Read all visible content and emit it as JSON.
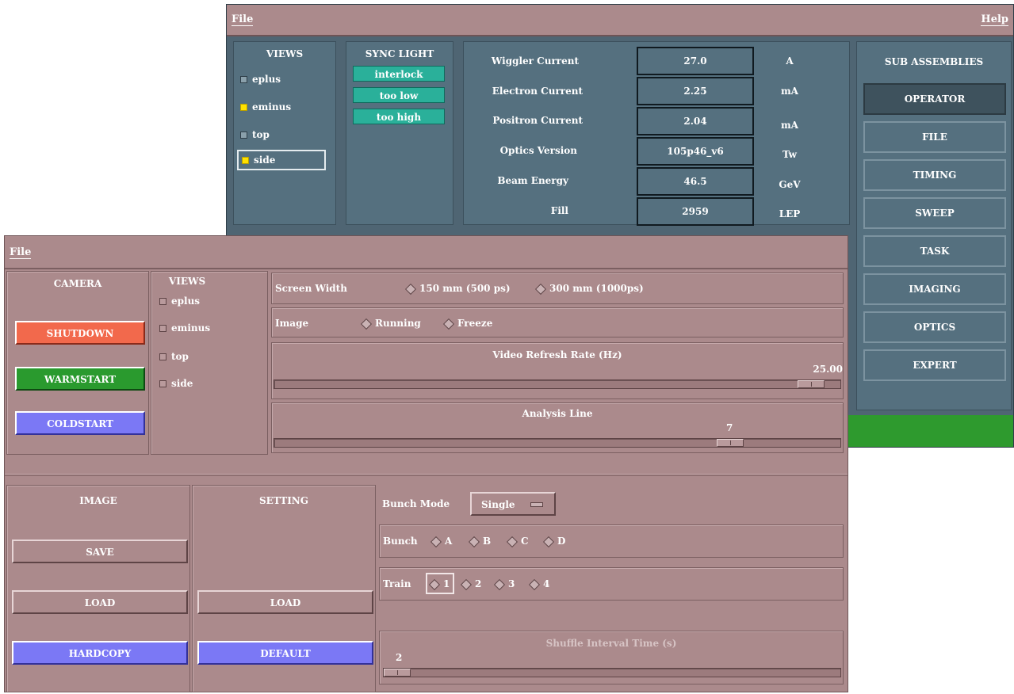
{
  "back_window": {
    "menu": {
      "file": "File",
      "help": "Help"
    },
    "views": {
      "title": "VIEWS",
      "items": [
        {
          "label": "eplus",
          "checked": false
        },
        {
          "label": "eminus",
          "checked": true
        },
        {
          "label": "top",
          "checked": false
        },
        {
          "label": "side",
          "checked": true
        }
      ]
    },
    "sync_light": {
      "title": "SYNC LIGHT",
      "buttons": [
        "interlock",
        "too low",
        "too high"
      ]
    },
    "parameters": [
      {
        "label": "Wiggler Current",
        "value": "27.0",
        "unit": "A"
      },
      {
        "label": "Electron Current",
        "value": "2.25",
        "unit": "mA"
      },
      {
        "label": "Positron Current",
        "value": "2.04",
        "unit": "mA"
      },
      {
        "label": "Optics Version",
        "value": "105p46_v6",
        "unit": "Tw"
      },
      {
        "label": "Beam Energy",
        "value": "46.5",
        "unit": "GeV"
      },
      {
        "label": "Fill",
        "value": "2959",
        "unit": "LEP"
      }
    ],
    "sub_assemblies": {
      "title": "SUB ASSEMBLIES",
      "buttons": [
        "OPERATOR",
        "FILE",
        "TIMING",
        "SWEEP",
        "TASK",
        "IMAGING",
        "OPTICS",
        "EXPERT"
      ],
      "active": "OPERATOR"
    }
  },
  "front_window": {
    "menu": {
      "file": "File"
    },
    "camera": {
      "title": "CAMERA",
      "shutdown": "SHUTDOWN",
      "warmstart": "WARMSTART",
      "coldstart": "COLDSTART"
    },
    "views": {
      "title": "VIEWS",
      "items": [
        {
          "label": "eplus",
          "checked": false
        },
        {
          "label": "eminus",
          "checked": false
        },
        {
          "label": "top",
          "checked": false
        },
        {
          "label": "side",
          "checked": false
        }
      ]
    },
    "screen_width": {
      "label": "Screen Width",
      "options": [
        "150 mm (500 ps)",
        "300 mm (1000ps)"
      ]
    },
    "image_mode": {
      "label": "Image",
      "options": [
        "Running",
        "Freeze"
      ]
    },
    "video_refresh": {
      "label": "Video Refresh Rate (Hz)",
      "value": "25.00",
      "fraction": 0.97
    },
    "analysis_line": {
      "label": "Analysis Line",
      "value": "7",
      "fraction": 0.82
    },
    "image": {
      "title": "IMAGE",
      "save": "SAVE",
      "load": "LOAD",
      "hardcopy": "HARDCOPY"
    },
    "setting": {
      "title": "SETTING",
      "load": "LOAD",
      "default": "DEFAULT"
    },
    "bunch_mode": {
      "label": "Bunch Mode",
      "value": "Single"
    },
    "bunch": {
      "label": "Bunch",
      "options": [
        "A",
        "B",
        "C",
        "D"
      ]
    },
    "train": {
      "label": "Train",
      "options": [
        "1",
        "2",
        "3",
        "4"
      ],
      "selected": "1"
    },
    "shuffle": {
      "label": "Shuffle Interval Time (s)",
      "value": "2",
      "fraction": 0.0
    }
  }
}
